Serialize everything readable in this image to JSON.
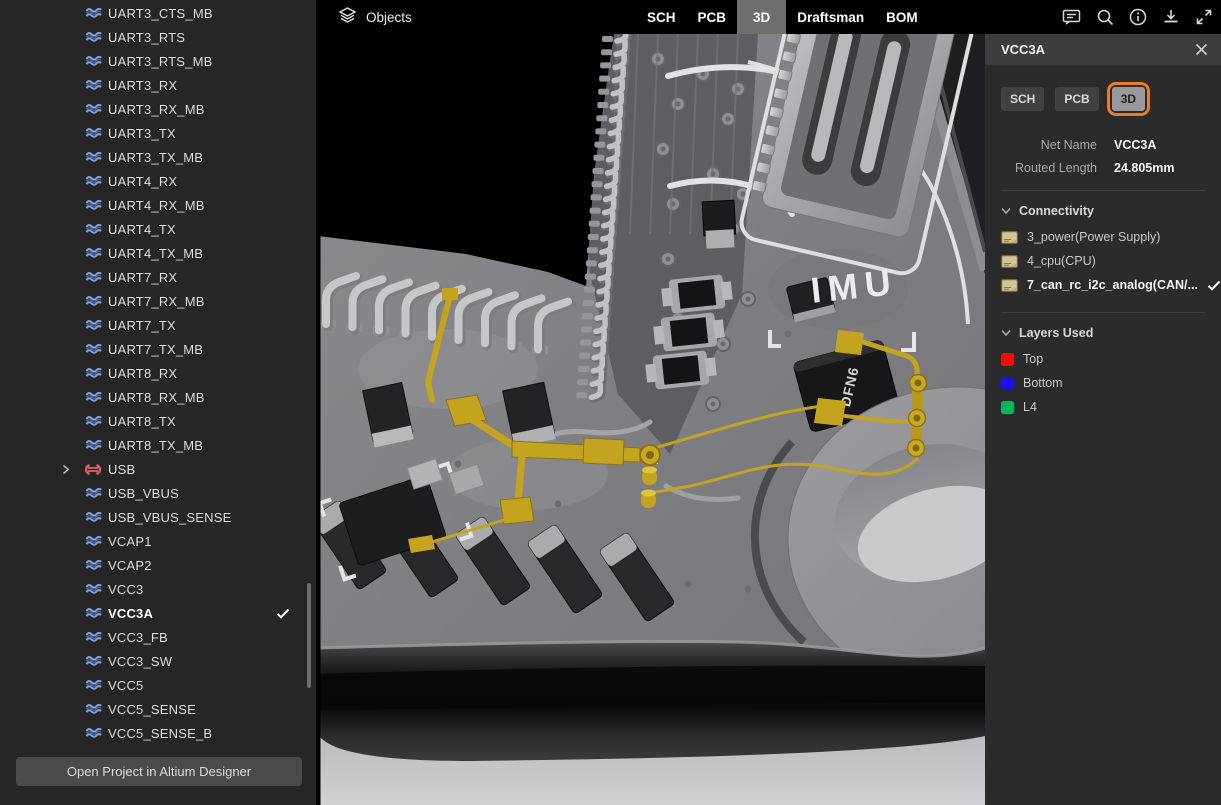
{
  "app": {
    "accent_color": "#e87d2c",
    "highlight_net_color": "#c4a41f"
  },
  "sidebar": {
    "items": [
      {
        "label": "UART3_CTS_MB",
        "icon": "net-icon"
      },
      {
        "label": "UART3_RTS",
        "icon": "net-icon"
      },
      {
        "label": "UART3_RTS_MB",
        "icon": "net-icon"
      },
      {
        "label": "UART3_RX",
        "icon": "net-icon"
      },
      {
        "label": "UART3_RX_MB",
        "icon": "net-icon"
      },
      {
        "label": "UART3_TX",
        "icon": "net-icon"
      },
      {
        "label": "UART3_TX_MB",
        "icon": "net-icon"
      },
      {
        "label": "UART4_RX",
        "icon": "net-icon"
      },
      {
        "label": "UART4_RX_MB",
        "icon": "net-icon"
      },
      {
        "label": "UART4_TX",
        "icon": "net-icon"
      },
      {
        "label": "UART4_TX_MB",
        "icon": "net-icon"
      },
      {
        "label": "UART7_RX",
        "icon": "net-icon"
      },
      {
        "label": "UART7_RX_MB",
        "icon": "net-icon"
      },
      {
        "label": "UART7_TX",
        "icon": "net-icon"
      },
      {
        "label": "UART7_TX_MB",
        "icon": "net-icon"
      },
      {
        "label": "UART8_RX",
        "icon": "net-icon"
      },
      {
        "label": "UART8_RX_MB",
        "icon": "net-icon"
      },
      {
        "label": "UART8_TX",
        "icon": "net-icon"
      },
      {
        "label": "UART8_TX_MB",
        "icon": "net-icon"
      },
      {
        "label": "USB",
        "icon": "diff-pair-icon",
        "chevron": true
      },
      {
        "label": "USB_VBUS",
        "icon": "net-icon"
      },
      {
        "label": "USB_VBUS_SENSE",
        "icon": "net-icon"
      },
      {
        "label": "VCAP1",
        "icon": "net-icon"
      },
      {
        "label": "VCAP2",
        "icon": "net-icon"
      },
      {
        "label": "VCC3",
        "icon": "net-icon"
      },
      {
        "label": "VCC3A",
        "icon": "net-icon",
        "bold": true,
        "checked": true
      },
      {
        "label": "VCC3_FB",
        "icon": "net-icon"
      },
      {
        "label": "VCC3_SW",
        "icon": "net-icon"
      },
      {
        "label": "VCC5",
        "icon": "net-icon"
      },
      {
        "label": "VCC5_SENSE",
        "icon": "net-icon"
      },
      {
        "label": "VCC5_SENSE_B",
        "icon": "net-icon"
      }
    ],
    "open_button_label": "Open Project in Altium Designer"
  },
  "topbar": {
    "objects_label": "Objects",
    "tabs": [
      {
        "label": "SCH"
      },
      {
        "label": "PCB"
      },
      {
        "label": "3D",
        "active": true
      },
      {
        "label": "Draftsman"
      },
      {
        "label": "BOM"
      }
    ],
    "icons": [
      {
        "name": "comment-icon"
      },
      {
        "name": "search-icon"
      },
      {
        "name": "info-icon"
      },
      {
        "name": "download-icon"
      },
      {
        "name": "fullscreen-icon"
      }
    ]
  },
  "viewport": {
    "silkscreen_imu": "IMU",
    "chip_label": "DFN6"
  },
  "panel": {
    "title": "VCC3A",
    "view_buttons": [
      {
        "label": "SCH"
      },
      {
        "label": "PCB"
      },
      {
        "label": "3D",
        "active": true,
        "annotated": true
      }
    ],
    "info": [
      {
        "label": "Net Name",
        "value": "VCC3A"
      },
      {
        "label": "Routed Length",
        "value": "24.805mm"
      }
    ],
    "connectivity": {
      "title": "Connectivity",
      "items": [
        {
          "label": "3_power(Power Supply)",
          "icon": "sheet-icon"
        },
        {
          "label": "4_cpu(CPU)",
          "icon": "sheet-icon"
        },
        {
          "label": "7_can_rc_i2c_analog(CAN/...",
          "icon": "sheet-icon",
          "bold": true,
          "checked": true
        }
      ]
    },
    "layers_used": {
      "title": "Layers Used",
      "items": [
        {
          "label": "Top",
          "color": "#fa0a06"
        },
        {
          "label": "Bottom",
          "color": "#1a10f0"
        },
        {
          "label": "L4",
          "color": "#07b35f"
        }
      ]
    }
  }
}
